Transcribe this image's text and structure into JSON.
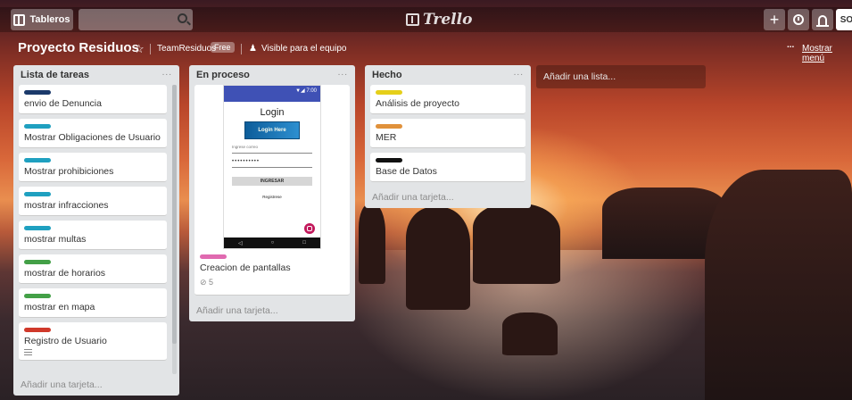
{
  "header": {
    "boards_label": "Tableros",
    "search_placeholder": "",
    "logo_text": "Trello",
    "plus_label": "+",
    "avatar_initials": "SO"
  },
  "board": {
    "title": "Proyecto Residuos",
    "team": "TeamResiduos",
    "team_badge": "Free",
    "visibility": "Visible para el equipo",
    "menu_link": "Mostrar menú",
    "menu_dots": "..."
  },
  "lists": [
    {
      "title": "Lista de tareas",
      "more": "...",
      "cards": [
        {
          "label_color": "#1b3a6b",
          "text": "envio de Denuncia"
        },
        {
          "label_color": "#1fa0c0",
          "text": "Mostrar Obligaciones de Usuario"
        },
        {
          "label_color": "#1fa0c0",
          "text": "Mostrar prohibiciones"
        },
        {
          "label_color": "#1fa0c0",
          "text": "mostrar infracciones"
        },
        {
          "label_color": "#1fa0c0",
          "text": "mostrar multas"
        },
        {
          "label_color": "#43a047",
          "text": "mostrar de horarios"
        },
        {
          "label_color": "#43a047",
          "text": "mostrar en mapa"
        },
        {
          "label_color": "#d0392b",
          "text": "Registro de Usuario"
        }
      ],
      "add_card": "Añadir una tarjeta..."
    },
    {
      "title": "En proceso",
      "more": "...",
      "cards": [
        {
          "label_color": "#e06ab0",
          "text": "Creacion de pantallas",
          "attachments": "5"
        }
      ],
      "mockup": {
        "status": "▼◢ 7:00",
        "title": "Login",
        "banner": "Login Here",
        "email_hint": "Ingrese correo",
        "password_mask": "••••••••••",
        "button": "INGRESAR",
        "link": "Registrese",
        "nav": [
          "◁",
          "○",
          "□"
        ]
      },
      "add_card": "Añadir una tarjeta..."
    },
    {
      "title": "Hecho",
      "more": "...",
      "cards": [
        {
          "label_color": "#e5cf1a",
          "text": "Análisis de proyecto"
        },
        {
          "label_color": "#e0913b",
          "text": "MER"
        },
        {
          "label_color": "#111111",
          "text": "Base de Datos"
        }
      ],
      "add_card": "Añadir una tarjeta..."
    }
  ],
  "add_list": "Añadir una lista..."
}
